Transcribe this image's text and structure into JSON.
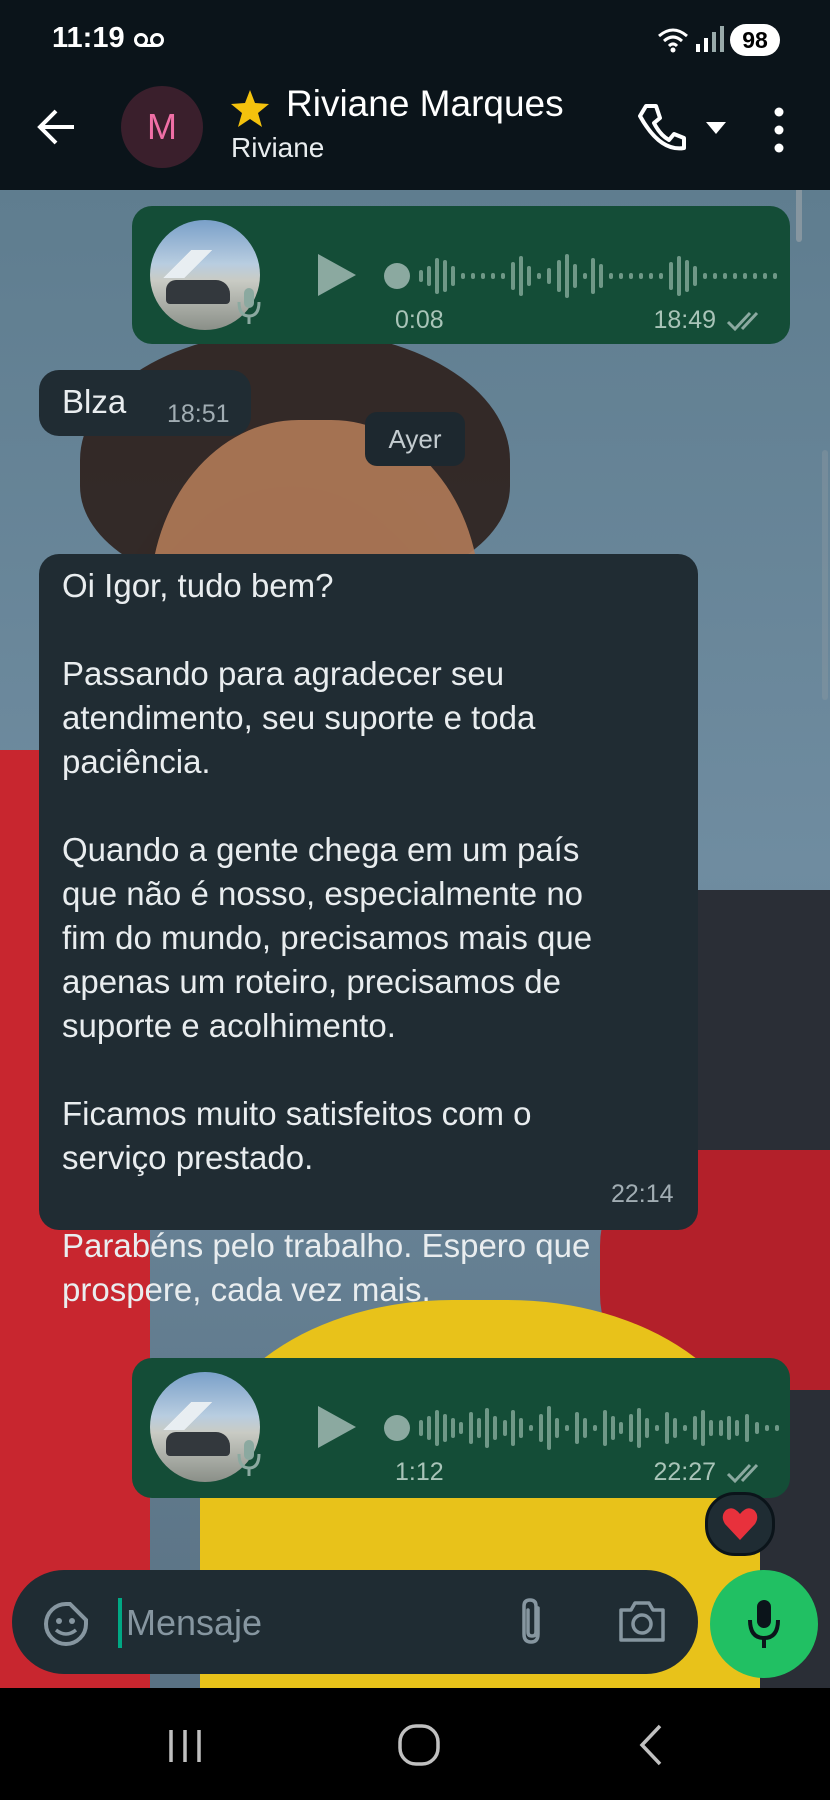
{
  "status_bar": {
    "time": "11:19",
    "battery": "98"
  },
  "header": {
    "avatar_initial": "M",
    "contact_name": "Riviane Marques",
    "contact_subtitle": "Riviane"
  },
  "messages": [
    {
      "type": "voice",
      "direction": "out",
      "duration": "0:08",
      "time": "18:49",
      "status": "read"
    },
    {
      "type": "text",
      "direction": "in",
      "text": "Blza",
      "time": "18:51"
    },
    {
      "type": "date",
      "label": "Ayer"
    },
    {
      "type": "text",
      "direction": "in",
      "text": "Oi Igor, tudo bem?\n\nPassando para agradecer seu\natendimento, seu suporte e toda\npaciência.\n\nQuando a gente chega em um país\nque não é nosso, especialmente no\nfim do mundo, precisamos mais que\napenas um roteiro, precisamos de\nsuporte e acolhimento.\n\nFicamos muito satisfeitos com o\nserviço prestado.\n\nParabéns pelo trabalho. Espero que\nprospere, cada vez mais.",
      "time": "22:14"
    },
    {
      "type": "voice",
      "direction": "out",
      "duration": "1:12",
      "time": "22:27",
      "status": "read",
      "reaction": "❤️"
    }
  ],
  "input": {
    "placeholder": "Mensaje",
    "value": ""
  },
  "icons": {
    "back": "arrow-left-icon",
    "star": "star-icon",
    "call": "phone-icon",
    "menu": "more-vertical-icon",
    "emoji": "sticker-icon",
    "attach": "paperclip-icon",
    "camera": "camera-icon",
    "mic": "microphone-icon"
  },
  "colors": {
    "outgoing_bubble": "#144d37",
    "incoming_bubble": "#202c33",
    "accent": "#21c063",
    "header_bg": "#0b141a"
  }
}
